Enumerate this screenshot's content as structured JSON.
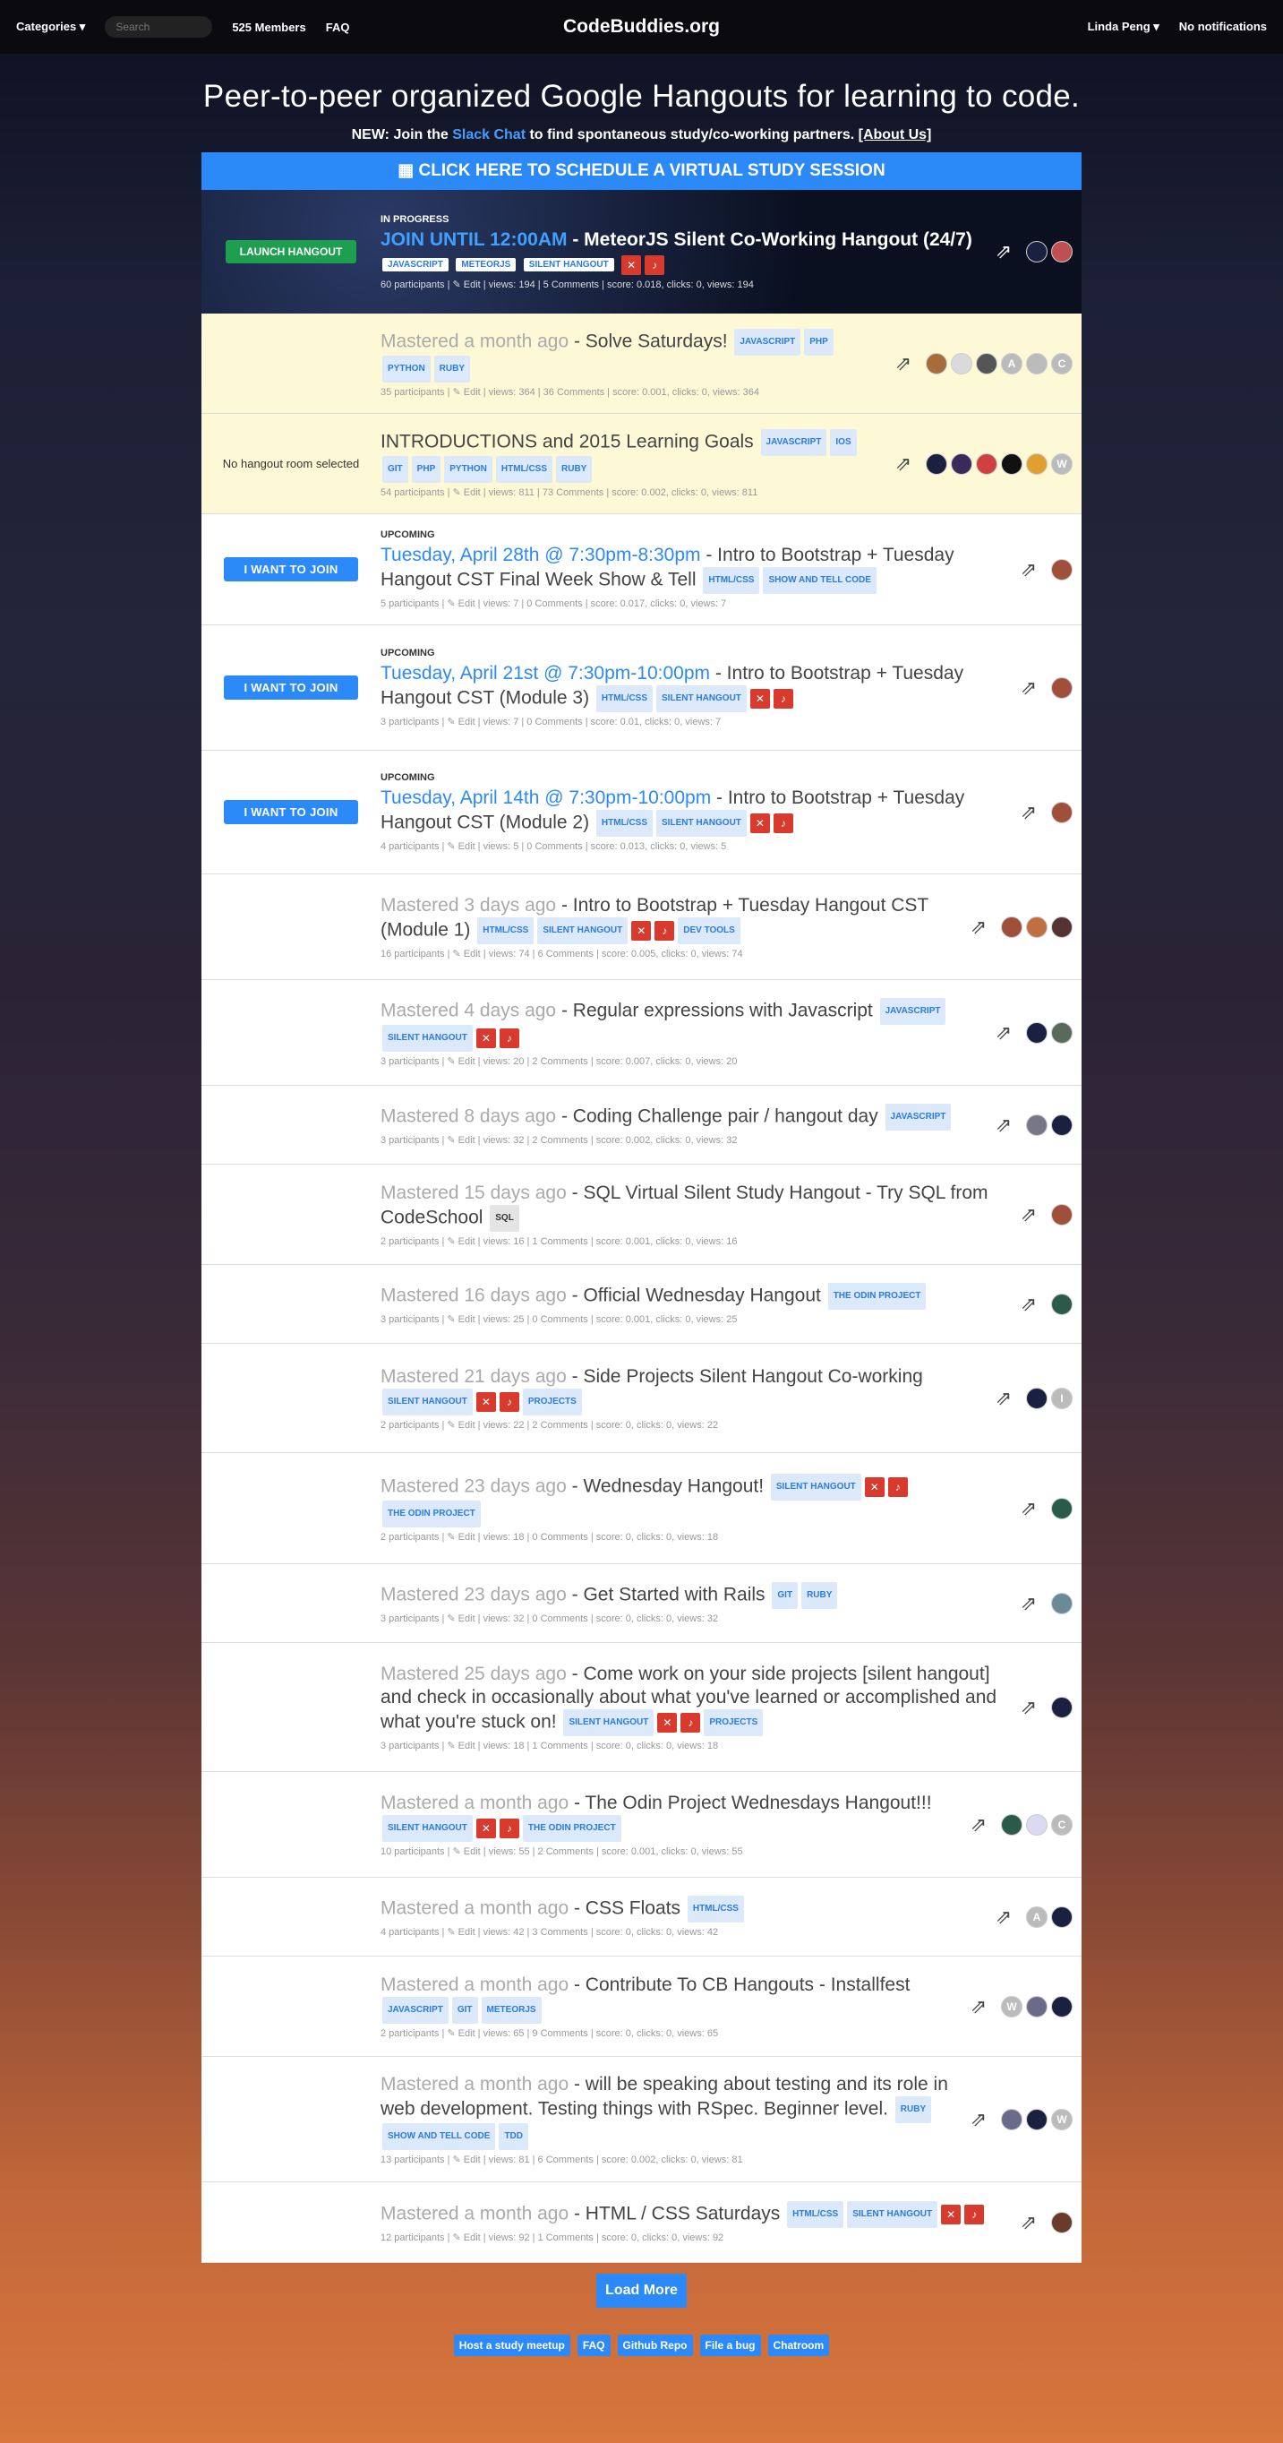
{
  "nav": {
    "categories": "Categories ▾",
    "search_placeholder": "Search",
    "members": "525 Members",
    "faq": "FAQ",
    "brand": "CodeBuddies.org",
    "user": "Linda Peng ▾",
    "notifications": "No notifications"
  },
  "hero": {
    "title": "Peer-to-peer organized Google Hangouts for learning to code.",
    "new_prefix": "NEW: Join the ",
    "slack": "Slack Chat",
    "new_suffix": " to find spontaneous study/co-working partners. ",
    "about": "[About Us]"
  },
  "schedule_label": "CLICK HERE TO SCHEDULE A VIRTUAL STUDY SESSION",
  "live": {
    "button": "LAUNCH HANGOUT",
    "status": "IN PROGRESS",
    "time": "JOIN UNTIL 12:00AM",
    "title": " - MeteorJS Silent Co-Working Hangout (24/7)",
    "tags": [
      "JAVASCRIPT",
      "METEORJS",
      "SILENT HANGOUT"
    ],
    "meta": "60 participants | ✎ Edit | views: 194 | 5 Comments | score: 0.018, clicks: 0, views: 194"
  },
  "rows": [
    {
      "style": "yellow",
      "left": "",
      "status": "",
      "time": "Mastered a month ago",
      "tclass": "time-past",
      "title": " - Solve Saturdays!",
      "tags": [
        "JAVASCRIPT",
        "PHP",
        "PYTHON",
        "RUBY"
      ],
      "icons": 0,
      "meta": "35 participants | ✎ Edit | views: 364 | 36 Comments | score: 0.001, clicks: 0, views: 364",
      "avatars": [
        "#a86b3a",
        "#dadada",
        "#555",
        "A",
        "#bbb",
        "C"
      ],
      "h": 112
    },
    {
      "style": "yellow",
      "left": "No hangout room selected",
      "status": "",
      "time": "",
      "tclass": "",
      "title": "INTRODUCTIONS and 2015 Learning Goals",
      "tags": [
        "JAVASCRIPT",
        "IOS",
        "GIT",
        "PHP",
        "PYTHON",
        "HTML/CSS",
        "RUBY"
      ],
      "icons": 0,
      "meta": "54 participants | ✎ Edit | views: 811 | 73 Comments | score: 0.002, clicks: 0, views: 811",
      "avatars": [
        "#1a2040",
        "#3a2a5a",
        "#d04040",
        "#111",
        "#e0a030",
        "W"
      ],
      "h": 112
    },
    {
      "style": "",
      "left": "I WANT TO JOIN",
      "status": "UPCOMING",
      "time": "Tuesday, April 28th @ 7:30pm-8:30pm",
      "tclass": "time-up",
      "title": " - Intro to Bootstrap + Tuesday Hangout CST Final Week Show & Tell",
      "tags": [
        "HTML/CSS",
        "SHOW AND TELL CODE"
      ],
      "icons": 0,
      "meta": "5 participants | ✎ Edit | views: 7 | 0 Comments | score: 0.017, clicks: 0, views: 7",
      "avatars": [
        "#a0503a"
      ],
      "h": 124
    },
    {
      "style": "",
      "left": "I WANT TO JOIN",
      "status": "UPCOMING",
      "time": "Tuesday, April 21st @ 7:30pm-10:00pm",
      "tclass": "time-up",
      "title": " - Intro to Bootstrap + Tuesday Hangout CST (Module 3)",
      "tags": [
        "HTML/CSS",
        "SILENT HANGOUT"
      ],
      "icons": 2,
      "meta": "3 participants | ✎ Edit | views: 7 | 0 Comments | score: 0.01, clicks: 0, views: 7",
      "avatars": [
        "#a0503a"
      ],
      "h": 140
    },
    {
      "style": "",
      "left": "I WANT TO JOIN",
      "status": "UPCOMING",
      "time": "Tuesday, April 14th @ 7:30pm-10:00pm",
      "tclass": "time-up",
      "title": " - Intro to Bootstrap + Tuesday Hangout CST (Module 2)",
      "tags": [
        "HTML/CSS",
        "SILENT HANGOUT"
      ],
      "icons": 2,
      "meta": "4 participants | ✎ Edit | views: 5 | 0 Comments | score: 0.013, clicks: 0, views: 5",
      "avatars": [
        "#a0503a"
      ],
      "h": 138
    },
    {
      "style": "",
      "left": "",
      "status": "",
      "time": "Mastered 3 days ago",
      "tclass": "time-past",
      "title": " - Intro to Bootstrap + Tuesday Hangout CST (Module 1)",
      "tags": [
        "HTML/CSS",
        "SILENT HANGOUT"
      ],
      "icons": 2,
      "tags2": [
        "DEV TOOLS"
      ],
      "meta": "16 participants | ✎ Edit | views: 74 | 6 Comments | score: 0.005, clicks: 0, views: 74",
      "avatars": [
        "#a0503a",
        "#c07040",
        "#553333"
      ],
      "h": 118
    },
    {
      "style": "",
      "left": "",
      "status": "",
      "time": "Mastered 4 days ago",
      "tclass": "time-past",
      "title": " - Regular expressions with Javascript",
      "tags": [
        "JAVASCRIPT",
        "SILENT HANGOUT"
      ],
      "icons": 2,
      "meta": "3 participants | ✎ Edit | views: 20 | 2 Comments | score: 0.007, clicks: 0, views: 20",
      "avatars": [
        "#1a2040",
        "#5a6a5a"
      ],
      "h": 118
    },
    {
      "style": "",
      "left": "",
      "status": "",
      "time": "Mastered 8 days ago",
      "tclass": "time-past",
      "title": " - Coding Challenge pair / hangout day",
      "tags": [
        "JAVASCRIPT"
      ],
      "icons": 0,
      "meta": "3 participants | ✎ Edit | views: 32 | 2 Comments | score: 0.002, clicks: 0, views: 32",
      "avatars": [
        "#778",
        "#1a2040"
      ],
      "h": 88
    },
    {
      "style": "",
      "left": "",
      "status": "",
      "time": "Mastered 15 days ago",
      "tclass": "time-past",
      "title": " - SQL Virtual Silent Study Hangout - Try SQL from CodeSchool",
      "tags": [
        "SQL"
      ],
      "icons": 0,
      "meta": "2 participants | ✎ Edit | views: 16 | 1 Comments | score: 0.001, clicks: 0, views: 16",
      "avatars": [
        "#a0503a"
      ],
      "h": 112
    },
    {
      "style": "",
      "left": "",
      "status": "",
      "time": "Mastered 16 days ago",
      "tclass": "time-past",
      "title": " - Official Wednesday Hangout",
      "tags": [
        "THE ODIN PROJECT"
      ],
      "icons": 0,
      "meta": "3 participants | ✎ Edit | views: 25 | 0 Comments | score: 0.001, clicks: 0, views: 25",
      "avatars": [
        "#2a5a4a"
      ],
      "h": 88
    },
    {
      "style": "",
      "left": "",
      "status": "",
      "time": "Mastered 21 days ago",
      "tclass": "time-past",
      "title": " - Side Projects Silent Hangout Co-working",
      "tags": [
        "SILENT HANGOUT"
      ],
      "icons": 2,
      "tags2": [
        "PROJECTS"
      ],
      "meta": "2 participants | ✎ Edit | views: 22 | 2 Comments | score: 0, clicks: 0, views: 22",
      "avatars": [
        "#1a2040",
        "I"
      ],
      "h": 122
    },
    {
      "style": "",
      "left": "",
      "status": "",
      "time": "Mastered 23 days ago",
      "tclass": "time-past",
      "title": " - Wednesday Hangout!",
      "tags": [
        "SILENT HANGOUT"
      ],
      "icons": 2,
      "tags2": [
        "THE ODIN PROJECT"
      ],
      "meta": "2 participants | ✎ Edit | views: 18 | 0 Comments | score: 0, clicks: 0, views: 18",
      "avatars": [
        "#2a5a4a"
      ],
      "h": 124
    },
    {
      "style": "",
      "left": "",
      "status": "",
      "time": "Mastered 23 days ago",
      "tclass": "time-past",
      "title": " - Get Started with Rails",
      "tags": [
        "GIT",
        "RUBY"
      ],
      "icons": 0,
      "meta": "3 participants | ✎ Edit | views: 32 | 0 Comments | score: 0, clicks: 0, views: 32",
      "avatars": [
        "#6a8a9a"
      ],
      "h": 88
    },
    {
      "style": "",
      "left": "",
      "status": "",
      "time": "Mastered 25 days ago",
      "tclass": "time-past",
      "title": " - Come work on your side projects [silent hangout] and check in occasionally about what you've learned or accomplished and what you're stuck on!",
      "tags": [
        "SILENT HANGOUT"
      ],
      "icons": 2,
      "tags2": [
        "PROJECTS"
      ],
      "meta": "3 participants | ✎ Edit | views: 18 | 1 Comments | score: 0, clicks: 0, views: 18",
      "avatars": [
        "#1a2040"
      ],
      "h": 144
    },
    {
      "style": "",
      "left": "",
      "status": "",
      "time": "Mastered a month ago",
      "tclass": "time-past",
      "title": " - The Odin Project Wednesdays Hangout!!!",
      "tags": [
        "SILENT HANGOUT"
      ],
      "icons": 2,
      "tags2": [
        "THE ODIN PROJECT"
      ],
      "meta": "10 participants | ✎ Edit | views: 55 | 2 Comments | score: 0.001, clicks: 0, views: 55",
      "avatars": [
        "#2a5a4a",
        "#dadaf0",
        "C"
      ],
      "h": 118
    },
    {
      "style": "",
      "left": "",
      "status": "",
      "time": "Mastered a month ago",
      "tclass": "time-past",
      "title": " - CSS Floats",
      "tags": [
        "HTML/CSS"
      ],
      "icons": 0,
      "meta": "4 participants | ✎ Edit | views: 42 | 3 Comments | score: 0, clicks: 0, views: 42",
      "avatars": [
        "A",
        "#1a2040"
      ],
      "h": 88
    },
    {
      "style": "",
      "left": "",
      "status": "",
      "time": "Mastered a month ago",
      "tclass": "time-past",
      "title": " - Contribute To CB Hangouts - Installfest",
      "tags": [
        "JAVASCRIPT",
        "GIT",
        "METEORJS"
      ],
      "icons": 0,
      "meta": "2 participants | ✎ Edit | views: 65 | 9 Comments | score: 0, clicks: 0, views: 65",
      "avatars": [
        "W",
        "#6a6a8a",
        "#1a2040"
      ],
      "h": 112
    },
    {
      "style": "",
      "left": "",
      "status": "",
      "time": "Mastered a month ago",
      "tclass": "time-past",
      "title": " - will be speaking about testing and its role in web development. Testing things with RSpec. Beginner level.",
      "tags": [
        "RUBY",
        "SHOW AND TELL CODE",
        "TDD"
      ],
      "icons": 0,
      "meta": "13 participants | ✎ Edit | views: 81 | 6 Comments | score: 0.002, clicks: 0, views: 81",
      "avatars": [
        "#6a6a8a",
        "#1a2040",
        "W"
      ],
      "h": 140
    },
    {
      "style": "",
      "left": "",
      "status": "",
      "time": "Mastered a month ago",
      "tclass": "time-past",
      "title": " - HTML / CSS Saturdays",
      "tags": [
        "HTML/CSS",
        "SILENT HANGOUT"
      ],
      "icons": 2,
      "meta": "12 participants | ✎ Edit | views: 92 | 1 Comments | score: 0, clicks: 0, views: 92",
      "avatars": [
        "#6a3a2a"
      ],
      "h": 90
    }
  ],
  "load_more": "Load More",
  "footer": [
    "Host a study meetup",
    "FAQ",
    "Github Repo",
    "File a bug",
    "Chatroom"
  ]
}
